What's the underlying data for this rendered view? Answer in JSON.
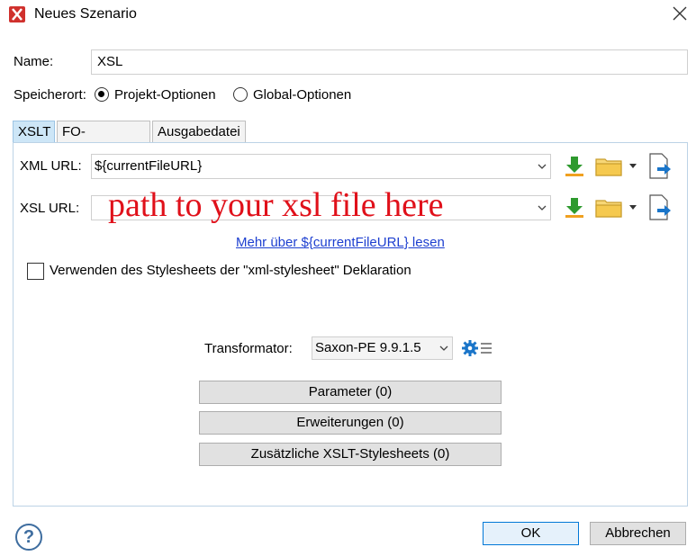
{
  "window": {
    "title": "Neues Szenario"
  },
  "name": {
    "label": "Name:",
    "value": "XSL"
  },
  "storage": {
    "label": "Speicherort:",
    "options": [
      {
        "label": "Projekt-Optionen",
        "checked": true
      },
      {
        "label": "Global-Optionen",
        "checked": false
      }
    ]
  },
  "tabs": [
    {
      "label": "XSLT",
      "active": true
    },
    {
      "label": "FO-Prozessor",
      "active": false
    },
    {
      "label": "Ausgabedatei",
      "active": false
    }
  ],
  "xslt": {
    "xml_url": {
      "label": "XML URL:",
      "value": "${currentFileURL}"
    },
    "xsl_url": {
      "label": "XSL URL:",
      "value": ""
    },
    "annotation": "path to your xsl file here",
    "more_link": "Mehr über ${currentFileURL} lesen",
    "use_stylesheet_checkbox": {
      "label": "Verwenden des Stylesheets der \"xml-stylesheet\" Deklaration",
      "checked": false
    },
    "transformer": {
      "label": "Transformator:",
      "value": "Saxon-PE 9.9.1.5"
    },
    "buttons": {
      "parameters": "Parameter (0)",
      "extensions": "Erweiterungen (0)",
      "additional_stylesheets": "Zusätzliche XSLT-Stylesheets (0)"
    }
  },
  "footer": {
    "help_icon": "?",
    "ok": "OK",
    "cancel": "Abbrechen"
  },
  "colors": {
    "accent": "#0078d7",
    "annotation": "#e0101a",
    "tab_active": "#cde6f7",
    "app_icon": "#d0312d"
  },
  "icons": [
    "app-logo-icon",
    "close-icon",
    "insert-editor-variables-icon",
    "folder-icon",
    "open-in-editor-icon",
    "chevron-down-icon",
    "settings-gear-icon",
    "help-icon"
  ]
}
